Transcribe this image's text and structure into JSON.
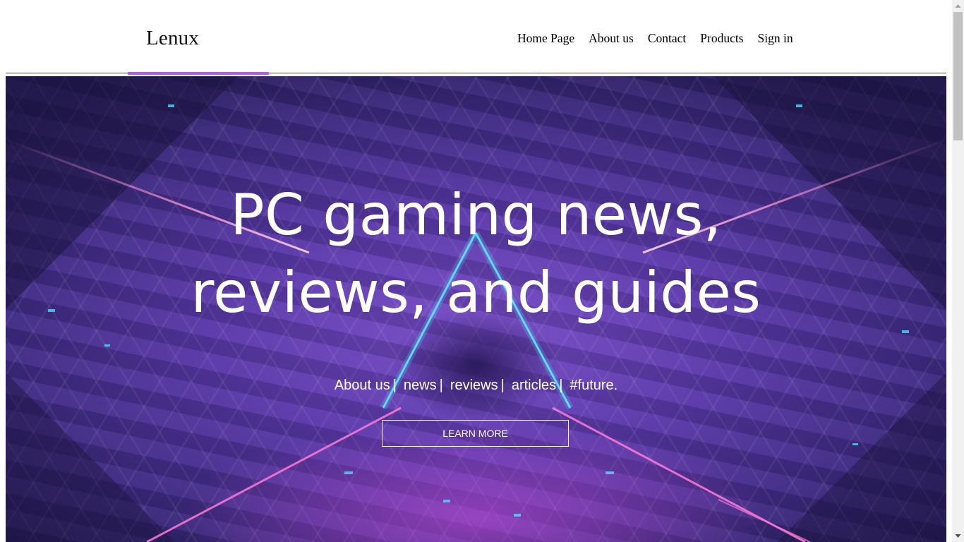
{
  "header": {
    "logo": "Lenux",
    "nav": [
      "Home Page",
      "About us",
      "Contact",
      "Products",
      "Sign in"
    ],
    "accent_color": "#b45de0"
  },
  "hero": {
    "headline_line1": "PC gaming news,",
    "headline_line2": "reviews, and guides",
    "tags": [
      "About us",
      "news",
      "reviews",
      "articles",
      "#future."
    ],
    "cta_label": "LEARN MORE",
    "palette": [
      "#7a4fc7",
      "#3b2a7a",
      "#4fd0ff",
      "#e24fd8"
    ]
  },
  "icons": {
    "scroll_up": "triangle-up-icon",
    "scroll_down": "triangle-down-icon"
  }
}
